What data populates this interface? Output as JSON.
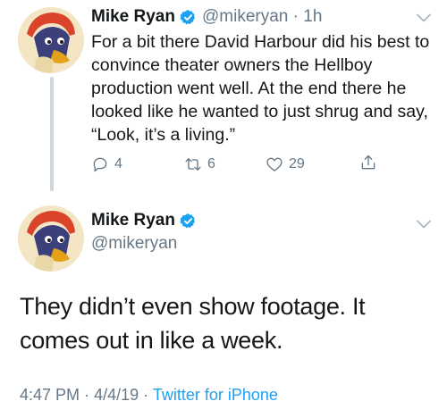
{
  "tweet1": {
    "display_name": "Mike Ryan",
    "handle": "@mikeryan",
    "separator": "·",
    "time_ago": "1h",
    "text": "For a bit there David Harbour did his best to convince theater owners the Hellboy production went well. At the end there he looked like he wanted to just shrug and say, “Look, it’s a living.”",
    "actions": {
      "replies": "4",
      "retweets": "6",
      "likes": "29"
    }
  },
  "tweet2": {
    "display_name": "Mike Ryan",
    "handle": "@mikeryan",
    "text": "They didn’t even show footage. It comes out in like a week.",
    "time": "4:47 PM",
    "dot": "·",
    "date": "4/4/19",
    "dot2": "·",
    "source": "Twitter for iPhone"
  },
  "icons": {
    "verified": "verified-badge-icon",
    "chevron": "chevron-down-icon",
    "reply": "reply-icon",
    "retweet": "retweet-icon",
    "like": "heart-icon",
    "share": "share-icon"
  },
  "colors": {
    "text": "#14171a",
    "secondary": "#657786",
    "link": "#1da1f2",
    "verified": "#1da1f2",
    "thread_line": "#ccd6dd"
  }
}
